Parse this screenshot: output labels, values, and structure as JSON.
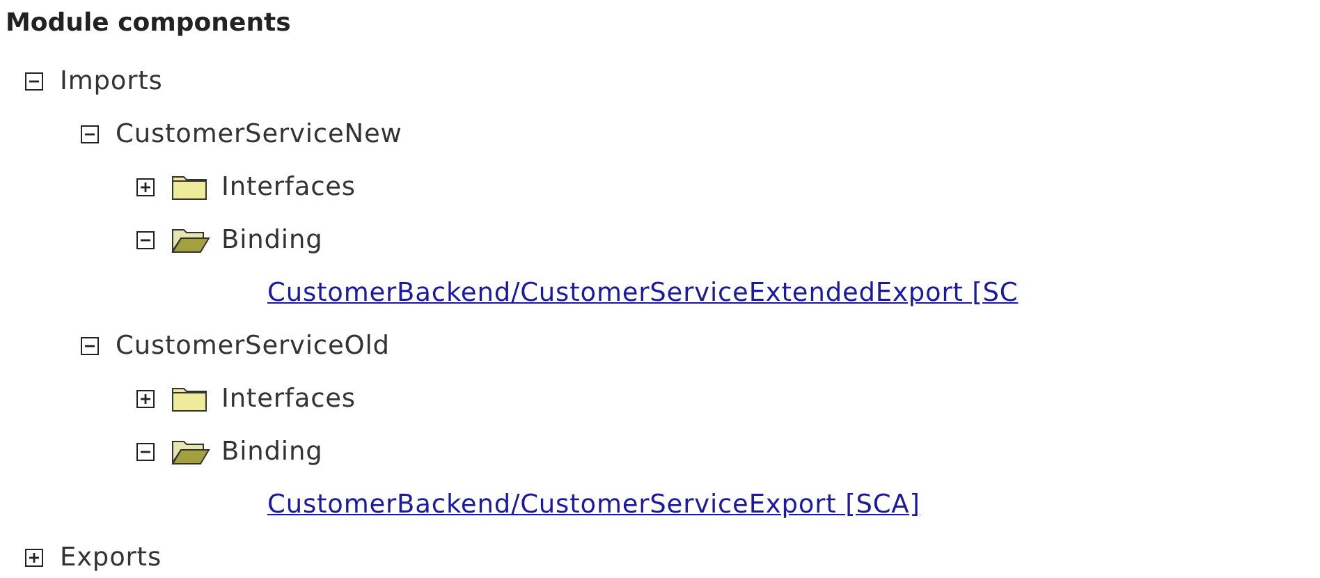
{
  "heading": "Module components",
  "tree": [
    {
      "kind": "group",
      "label": "Imports",
      "expanded": true,
      "children": [
        {
          "kind": "group",
          "label": "CustomerServiceNew",
          "expanded": true,
          "children": [
            {
              "kind": "folder",
              "label": "Interfaces",
              "expanded": false
            },
            {
              "kind": "folder",
              "label": "Binding",
              "expanded": true,
              "children": [
                {
                  "kind": "link",
                  "label": "CustomerBackend/CustomerServiceExtendedExport [SC"
                }
              ]
            }
          ]
        },
        {
          "kind": "group",
          "label": "CustomerServiceOld",
          "expanded": true,
          "children": [
            {
              "kind": "folder",
              "label": "Interfaces",
              "expanded": false
            },
            {
              "kind": "folder",
              "label": "Binding",
              "expanded": true,
              "children": [
                {
                  "kind": "link",
                  "label": "CustomerBackend/CustomerServiceExport [SCA]"
                }
              ]
            }
          ]
        }
      ]
    },
    {
      "kind": "group",
      "label": "Exports",
      "expanded": false
    }
  ]
}
